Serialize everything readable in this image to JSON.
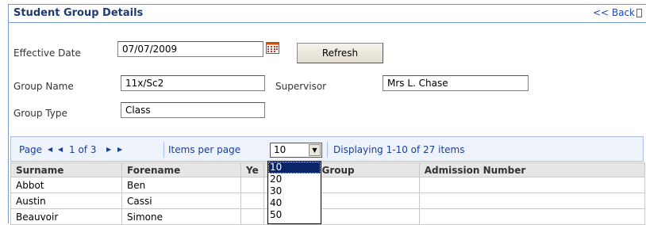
{
  "header": {
    "title": "Student Group Details",
    "back_label": "<< Back"
  },
  "form": {
    "effective_date_label": "Effective Date",
    "effective_date_value": "07/07/2009",
    "refresh_label": "Refresh",
    "group_name_label": "Group Name",
    "group_name_value": "11x/Sc2",
    "supervisor_label": "Supervisor",
    "supervisor_value": "Mrs L. Chase",
    "group_type_label": "Group Type",
    "group_type_value": "Class"
  },
  "pager": {
    "page_label": "Page",
    "first_icon": "◀",
    "prev_icon": "◀",
    "page_info": "1 of 3",
    "next_icon": "▶",
    "last_icon": "▶",
    "items_per_page_label": "Items per page",
    "items_per_page_value": "10",
    "displaying": "Displaying 1-10 of 27 items",
    "options": [
      "10",
      "20",
      "30",
      "40",
      "50"
    ]
  },
  "table": {
    "headers": [
      "Surname",
      "Forename",
      "Ye",
      "g Group",
      "Admission Number"
    ],
    "rows": [
      [
        "Abbot",
        "Ben",
        "",
        "",
        ""
      ],
      [
        "Austin",
        "Cassi",
        "",
        "",
        ""
      ],
      [
        "Beauvoir",
        "Simone",
        "",
        "",
        ""
      ]
    ]
  },
  "colors": {
    "link": "#1a44c8",
    "title": "#1f3a73",
    "selection": "#0a246a"
  }
}
